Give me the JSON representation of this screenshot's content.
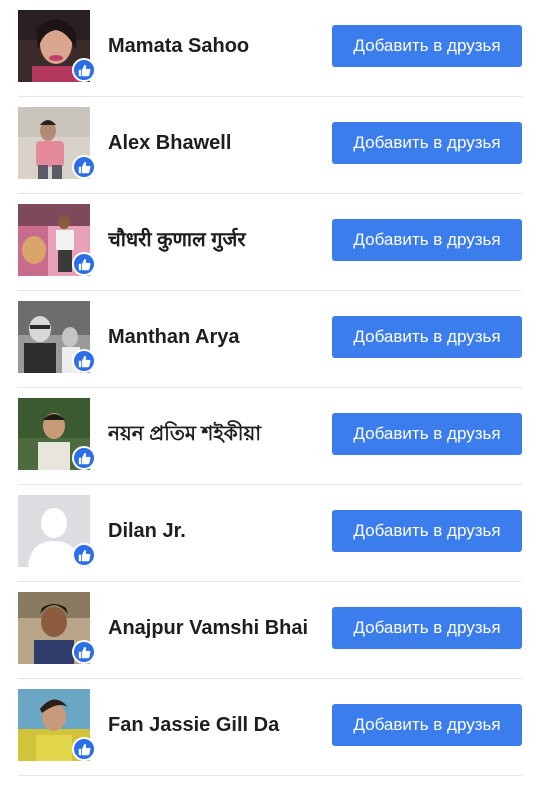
{
  "accent_color": "#3b7ded",
  "like_badge_color": "#2c6ee8",
  "badge_icon": "thumbs-up-icon",
  "people": [
    {
      "name": "Mamata Sahoo",
      "button_label": "Добавить в друзья"
    },
    {
      "name": "Alex Bhawell",
      "button_label": "Добавить в друзья"
    },
    {
      "name": "चौधरी कुणाल गुर्जर",
      "button_label": "Добавить в друзья"
    },
    {
      "name": "Manthan Arya",
      "button_label": "Добавить в друзья"
    },
    {
      "name": "নয়ন প্ৰতিম শইকীয়া",
      "button_label": "Добавить в друзья"
    },
    {
      "name": "Dilan Jr.",
      "button_label": "Добавить в друзья"
    },
    {
      "name": "Anajpur Vamshi Bhai",
      "button_label": "Добавить в друзья"
    },
    {
      "name": "Fan Jassie Gill Da",
      "button_label": "Добавить в друзья"
    }
  ]
}
